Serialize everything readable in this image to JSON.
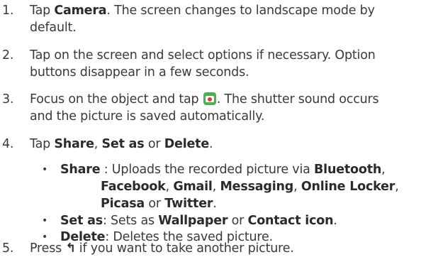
{
  "steps": [
    {
      "num": "1.",
      "line1_pre": "Tap ",
      "line1_bold": "Camera",
      "line1_post": ". The screen changes to landscape mode by",
      "line2": "default."
    },
    {
      "num": "2.",
      "line1": "Tap on the screen and select options if necessary. Option",
      "line2": "buttons disappear in a few seconds."
    },
    {
      "num": "3.",
      "line1_pre": "Focus on the object and tap ",
      "line1_post": ". The shutter sound occurs",
      "line2": "and the picture is saved automatically."
    },
    {
      "num": "4.",
      "pre": "Tap ",
      "share": "Share",
      "sep1": ", ",
      "setas": "Set as",
      "sep2": " or ",
      "delete": "Delete",
      "end": "."
    },
    {
      "num": "5.",
      "pre": "Press ",
      "post": " if you want to take another picture."
    }
  ],
  "bullets": {
    "share": {
      "label": "Share",
      "desc_pre": " : Uploads the recorded picture via ",
      "bluetooth": "Bluetooth",
      "c1": ",",
      "facebook": "Facebook",
      "c2": ", ",
      "gmail": "Gmail",
      "c3": ", ",
      "messaging": "Messaging",
      "c4": ", ",
      "online_locker": "Online Locker",
      "c5": ",",
      "picasa": "Picasa",
      "or": " or ",
      "twitter": "Twitter",
      "end": "."
    },
    "setas": {
      "label": "Set as",
      "desc_pre": ": Sets as ",
      "wallpaper": "Wallpaper",
      "or": " or ",
      "contact_icon": "Contact icon",
      "end": "."
    },
    "delete": {
      "label": "Delete",
      "desc": ": Deletes the saved picture."
    }
  },
  "icons": {
    "camera_shutter": "camera-shutter-icon",
    "back": "back-arrow-icon"
  }
}
